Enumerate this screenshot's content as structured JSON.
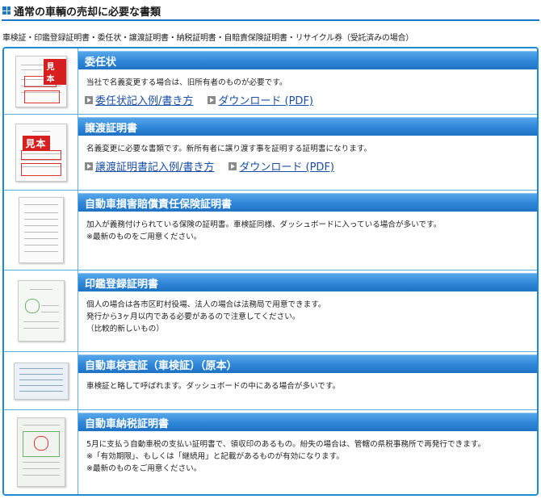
{
  "page": {
    "title": "通常の車輌の売却に必要な書類",
    "summary": "車検証・印鑑登録証明書・委任状・譲渡証明書・納税証明書・自賠責保険証明書・リサイクル券（受託済みの場合）"
  },
  "stamp_label": "見本",
  "colors": {
    "accent": "#1e78c8",
    "band": "#2f86d8",
    "link": "#1a4ea6",
    "stamp": "#d81f1f"
  },
  "items": [
    {
      "title": "委任状",
      "lines": [
        "当社で名義変更する場合は、旧所有者のものが必要です。"
      ],
      "link1": "委任状記入例/書き方",
      "link2": "ダウンロード (PDF)"
    },
    {
      "title": "譲渡証明書",
      "lines": [
        "名義変更に必要な書類です。新所有者に譲り渡す事を証明する証明書になります。"
      ],
      "link1": "譲渡証明書記入例/書き方",
      "link2": "ダウンロード (PDF)"
    },
    {
      "title": "自動車損害賠償責任保険証明書",
      "lines": [
        "加入が義務付けられている保険の証明書。車検証同様、ダッシュボードに入っている場合が多いです。",
        "※最新のものをご用意ください。"
      ]
    },
    {
      "title": "印鑑登録証明書",
      "lines": [
        "個人の場合は各市区町村役場、法人の場合は法務局で用意できます。",
        "発行から3ヶ月以内である必要があるので注意してください。",
        "（比較的新しいもの）"
      ]
    },
    {
      "title": "自動車検査証（車検証）（原本）",
      "lines": [
        "車検証と略して呼ばれます。ダッシュボードの中にある場合が多いです。"
      ]
    },
    {
      "title": "自動車納税証明書",
      "lines": [
        "5月に支払う自動車税の支払い証明書で、領収印のあるもの。紛失の場合は、管轄の県税事務所で再発行できます。",
        "※「有効期限」、もしくは「継続用」と記載があるものが有効になります。",
        "※最新のものをご用意ください。"
      ]
    }
  ]
}
